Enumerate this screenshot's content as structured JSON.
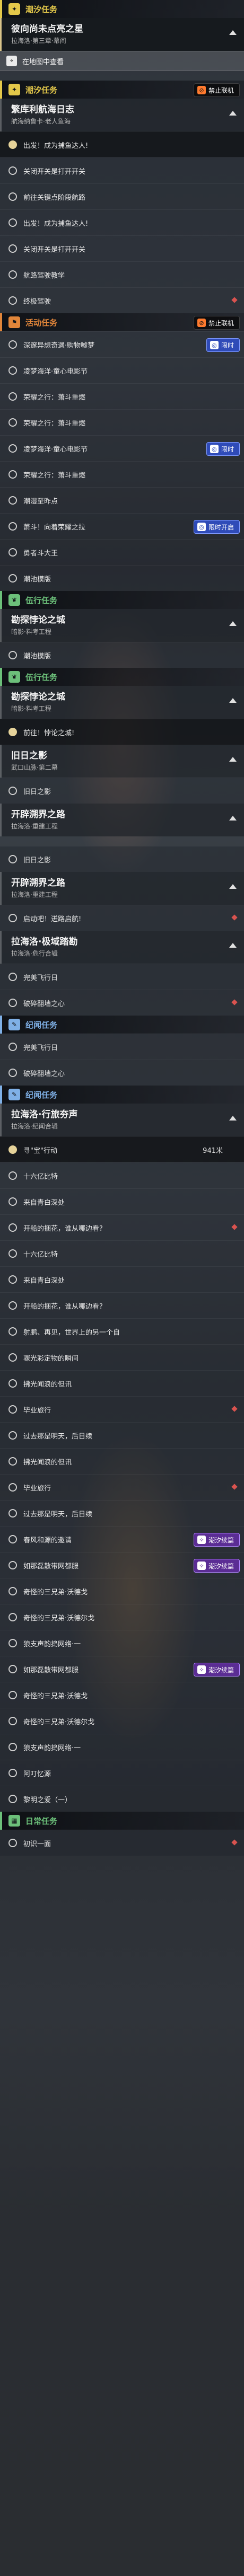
{
  "sections": [
    {
      "type": "category",
      "label": "潮汐任务",
      "color": "#e4c84a",
      "icon": "star-icon"
    },
    {
      "type": "mission",
      "title": "彼向尚未点亮之星",
      "subtitle": "拉海洛·第三章·幕间",
      "selected": true
    },
    {
      "type": "nav",
      "label": "在地图中查看"
    },
    {
      "type": "gap"
    },
    {
      "type": "category",
      "label": "潮汐任务",
      "color": "#e4c84a",
      "icon": "star-icon",
      "badge": {
        "style": "coop",
        "label": "禁止联机"
      }
    },
    {
      "type": "mission",
      "title": "繁库利航海日志",
      "subtitle": "航海纳鲁卡·老人鱼海",
      "selected": false
    },
    {
      "type": "step",
      "text": "出发！成为捕鱼达人!",
      "track": true
    },
    {
      "type": "step",
      "text": "关闭开关是打开开关",
      "track": false
    },
    {
      "type": "step",
      "text": "前往关键点阶段航路",
      "track": false
    },
    {
      "type": "step",
      "text": "出发！成为捕鱼达人!",
      "track": false
    },
    {
      "type": "step",
      "text": "关闭开关是打开开关",
      "track": false
    },
    {
      "type": "step",
      "text": "航路驾驶教学",
      "track": false
    },
    {
      "type": "step",
      "text": "终极驾驶",
      "track": false,
      "marker": true
    },
    {
      "type": "category",
      "label": "活动任务",
      "color": "#e2863a",
      "icon": "flag-icon",
      "badge": {
        "style": "coop",
        "label": "禁止联机"
      }
    },
    {
      "type": "step",
      "text": "深邃异想奇遇·购物嘘梦",
      "track": false,
      "badge": {
        "style": "blue",
        "label": "限时"
      }
    },
    {
      "type": "step",
      "text": "凌梦海洋·童心电影节",
      "track": false
    },
    {
      "type": "step",
      "text": "荣耀之行：萧斗重燃",
      "track": false
    },
    {
      "type": "step",
      "text": "荣耀之行：萧斗重燃",
      "track": false
    },
    {
      "type": "step",
      "text": "凌梦海洋·童心电影节",
      "track": false,
      "badge": {
        "style": "blue",
        "label": "限时"
      }
    },
    {
      "type": "step",
      "text": "荣耀之行：萧斗重燃",
      "track": false
    },
    {
      "type": "step",
      "text": "潮湿至昨点",
      "track": false
    },
    {
      "type": "step",
      "text": "萧斗！向着荣耀之拉",
      "track": false,
      "badge": {
        "style": "blue",
        "label": "限时开启"
      }
    },
    {
      "type": "step",
      "text": "勇者斗大王",
      "track": false
    },
    {
      "type": "step",
      "text": "潮池模版",
      "track": false
    },
    {
      "type": "category",
      "label": "伍行任务",
      "color": "#6cc07a",
      "icon": "leaf-icon"
    },
    {
      "type": "mission",
      "title": "勘探悖论之城",
      "subtitle": "暗影·料考工程",
      "selected": false
    },
    {
      "type": "step",
      "text": "潮池模版",
      "track": false
    },
    {
      "type": "category",
      "label": "伍行任务",
      "color": "#6cc07a",
      "icon": "leaf-icon"
    },
    {
      "type": "mission",
      "title": "勘探悖论之城",
      "subtitle": "暗影·料考工程",
      "selected": false
    },
    {
      "type": "step",
      "text": "前往！悖论之城!",
      "track": true
    },
    {
      "type": "mission",
      "title": "旧日之影",
      "subtitle": "武口山脉·第二幕",
      "selected": false
    },
    {
      "type": "step",
      "text": "旧日之影",
      "track": false
    },
    {
      "type": "mission",
      "title": "开辟溯界之路",
      "subtitle": "拉海洛·重建工程",
      "selected": false
    },
    {
      "type": "gap"
    },
    {
      "type": "step",
      "text": "旧日之影",
      "track": false
    },
    {
      "type": "mission",
      "title": "开辟溯界之路",
      "subtitle": "拉海洛·重建工程",
      "selected": false
    },
    {
      "type": "step",
      "text": "启动吧！迸路启航!",
      "track": false,
      "marker": true
    },
    {
      "type": "mission",
      "title": "拉海洛·极域踏勘",
      "subtitle": "拉海洛·危行合辑",
      "selected": false
    },
    {
      "type": "step",
      "text": "完美飞行日",
      "track": false
    },
    {
      "type": "step",
      "text": "破碎翻墙之心",
      "track": false,
      "marker": true
    },
    {
      "type": "category",
      "label": "纪闻任务",
      "color": "#7fb0e6",
      "icon": "book-icon"
    },
    {
      "type": "step",
      "text": "完美飞行日",
      "track": false
    },
    {
      "type": "step",
      "text": "破碎翻墙之心",
      "track": false
    },
    {
      "type": "category",
      "label": "纪闻任务",
      "color": "#7fb0e6",
      "icon": "book-icon"
    },
    {
      "type": "mission",
      "title": "拉海洛·行旅夯声",
      "subtitle": "拉海洛·纪闻合辑",
      "selected": false
    },
    {
      "type": "step",
      "text": "寻\"宝\"行动",
      "track": true,
      "value": "941米"
    },
    {
      "type": "step",
      "text": "十六亿比特",
      "track": false
    },
    {
      "type": "step",
      "text": "来自青白深处",
      "track": false
    },
    {
      "type": "step",
      "text": "开船的捆花，谁从哪边看?",
      "track": false,
      "marker": true
    },
    {
      "type": "step",
      "text": "十六亿比特",
      "track": false
    },
    {
      "type": "step",
      "text": "来自青白深处",
      "track": false
    },
    {
      "type": "step",
      "text": "开船的捆花，谁从哪边看?",
      "track": false
    },
    {
      "type": "step",
      "text": "射鹏、再见，世界上的另一个自",
      "track": false
    },
    {
      "type": "step",
      "text": "骤光彩定物的瞬间",
      "track": false
    },
    {
      "type": "step",
      "text": "拂光闻浪的但讯",
      "track": false
    },
    {
      "type": "step",
      "text": "毕业旅行",
      "track": false,
      "marker": true
    },
    {
      "type": "step",
      "text": "过去那是明天，后日续",
      "track": false
    },
    {
      "type": "step",
      "text": "拂光闻浪的但讯",
      "track": false
    },
    {
      "type": "step",
      "text": "毕业旅行",
      "track": false,
      "marker": true
    },
    {
      "type": "step",
      "text": "过去那是明天，后日续",
      "track": false
    },
    {
      "type": "step",
      "text": "春风和源的邀请",
      "track": false,
      "badge": {
        "style": "purple",
        "label": "潮汐续篇"
      }
    },
    {
      "type": "step",
      "text": "如那磊散带网都服",
      "track": false,
      "badge": {
        "style": "purple",
        "label": "潮汐续篇"
      }
    },
    {
      "type": "step",
      "text": "奇怪的三兄弟·沃德戈",
      "track": false
    },
    {
      "type": "step",
      "text": "奇怪的三兄弟·沃德尔戈",
      "track": false
    },
    {
      "type": "step",
      "text": "狼支声韵捣网络·一",
      "track": false
    },
    {
      "type": "step",
      "text": "如那磊散带网都服",
      "track": false,
      "badge": {
        "style": "purple",
        "label": "潮汐续篇"
      }
    },
    {
      "type": "step",
      "text": "奇怪的三兄弟·沃德戈",
      "track": false
    },
    {
      "type": "step",
      "text": "奇怪的三兄弟·沃德尔戈",
      "track": false
    },
    {
      "type": "step",
      "text": "狼支声韵捣网络·一",
      "track": false
    },
    {
      "type": "step",
      "text": "阿叮忆源",
      "track": false
    },
    {
      "type": "step",
      "text": "黎明之爱（一）",
      "track": false
    },
    {
      "type": "category",
      "label": "日常任务",
      "color": "#6cc07a",
      "icon": "calendar-icon"
    },
    {
      "type": "step",
      "text": "初识一面",
      "track": false,
      "marker": true
    }
  ]
}
